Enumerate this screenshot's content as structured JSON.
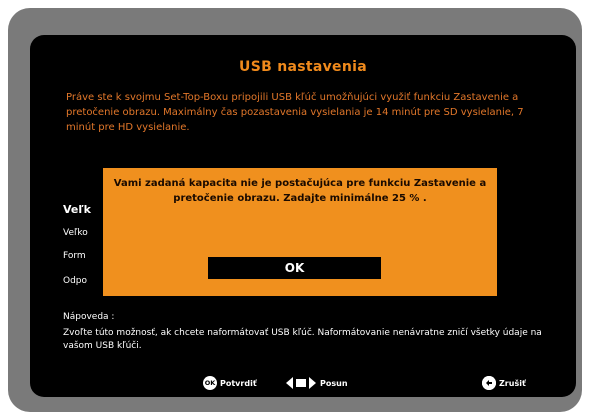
{
  "screen": {
    "title": "USB nastavenia",
    "intro": "Práve ste k svojmu Set-Top-Boxu pripojili USB kľúč umožňujúci využiť funkciu Zastavenie a pretočenie obrazu. Maximálny čas pozastavenia vysielania je 14 minút pre SD vysielanie, 7 minút pre HD vysielanie."
  },
  "rows": {
    "r0": "Veľk",
    "r1": "Veľko",
    "r2": "Form",
    "r3": "Odpo"
  },
  "help": {
    "title": "Nápoveda :",
    "text": "Zvoľte túto možnosť, ak chcete naformátovať USB kľúč. Naformátovanie nenávratne zničí všetky údaje na vašom USB kľúči."
  },
  "footer": {
    "ok_badge": "OK",
    "confirm_label": "Potvrdiť",
    "move_label": "Posun",
    "cancel_label": "Zrušiť"
  },
  "dialog": {
    "message": "Vami zadaná kapacita nie je postačujúca pre funkciu Zastavenie a pretočenie obrazu. Zadajte minimálne 25 % .",
    "ok_label": "OK"
  },
  "colors": {
    "accent": "#f08a1c",
    "dialog_bg": "#f0901e",
    "frame": "#7a7a7a"
  }
}
